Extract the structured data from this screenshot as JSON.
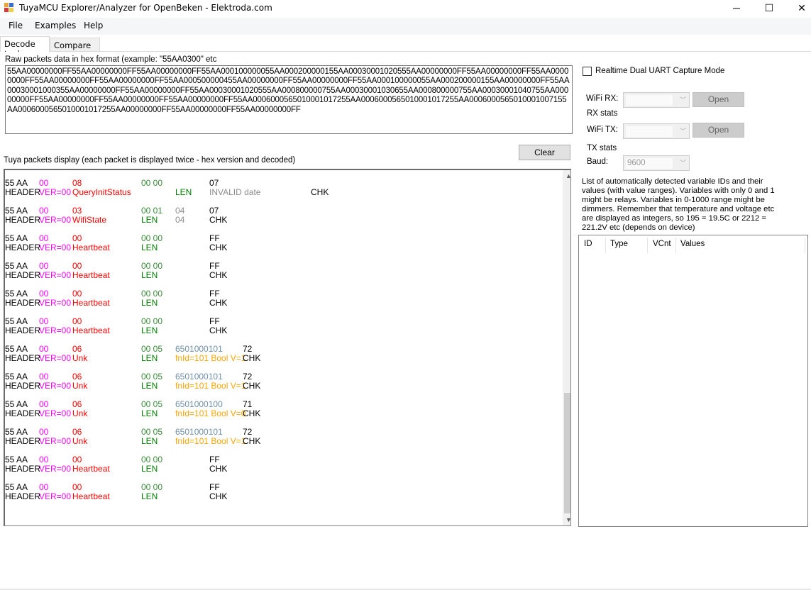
{
  "window": {
    "title": "TuyaMCU Explorer/Analyzer for OpenBeken - Elektroda.com",
    "minimize": "─",
    "maximize": "☐",
    "close": "✕"
  },
  "menu": [
    "File",
    "Examples",
    "Help"
  ],
  "tabs": [
    "Decode tool",
    "Compare tool"
  ],
  "raw": {
    "label": "Raw packets data in hex format (example: \"55AA0300\" etc",
    "value": "55AA00000000FF55AA00000000FF55AA00000000FF55AA000100000055AA000200000155AA00030001020555AA00000000FF55AA00000000FF55AA00000000FF55AA00000000FF55AA00000000FF55AA000500000455AA00000000FF55AA00000000FF55AA000100000055AA000200000155AA00000000FF55AA00030001000355AA00000000FF55AA00000000FF55AA00030001020555AA000800000755AA00030001030655AA000800000755AA00030001040755AA00000000FF55AA00000000FF55AA00000000FF55AA00000000FF55AA0006000565010001017255AA0006000565010001017255AA0006000565010001007155AA0006000565010001017255AA00000000FF55AA00000000FF55AA00000000FF"
  },
  "display": {
    "label": "Tuya packets display (each packet is displayed twice - hex version and decoded)",
    "clear": "Clear"
  },
  "packets": [
    {
      "top": [
        [
          "header",
          "55 AA",
          "black"
        ],
        [
          "ver",
          "00",
          "mag"
        ],
        [
          "cmd",
          "08",
          "red"
        ],
        [
          "len",
          "00 00",
          "teal"
        ],
        [
          "chk",
          "07",
          "black"
        ]
      ],
      "bottom": [
        [
          "header",
          "HEADER",
          "black"
        ],
        [
          "ver",
          "VER=00",
          "mag"
        ],
        [
          "cmd",
          "QueryInitStatus",
          "red"
        ],
        [
          "data",
          "LEN",
          "green"
        ],
        [
          "chk",
          "INVALID date",
          "gray"
        ],
        [
          "extra",
          "CHK",
          "black"
        ]
      ]
    },
    {
      "top": [
        [
          "header",
          "55 AA",
          "black"
        ],
        [
          "ver",
          "00",
          "mag"
        ],
        [
          "cmd",
          "03",
          "red"
        ],
        [
          "len",
          "00 01",
          "teal"
        ],
        [
          "data",
          "04",
          "gray"
        ],
        [
          "chk",
          "07",
          "black"
        ]
      ],
      "bottom": [
        [
          "header",
          "HEADER",
          "black"
        ],
        [
          "ver",
          "VER=00",
          "mag"
        ],
        [
          "cmd",
          "WifiState",
          "red"
        ],
        [
          "len",
          "LEN",
          "green"
        ],
        [
          "data",
          "04",
          "gray"
        ],
        [
          "chk",
          "CHK",
          "black"
        ]
      ]
    },
    {
      "top": [
        [
          "header",
          "55 AA",
          "black"
        ],
        [
          "ver",
          "00",
          "mag"
        ],
        [
          "cmd",
          "00",
          "red"
        ],
        [
          "len",
          "00 00",
          "teal"
        ],
        [
          "chk",
          "FF",
          "black"
        ]
      ],
      "bottom": [
        [
          "header",
          "HEADER",
          "black"
        ],
        [
          "ver",
          "VER=00",
          "mag"
        ],
        [
          "cmd",
          "Heartbeat",
          "red"
        ],
        [
          "len",
          "LEN",
          "green"
        ],
        [
          "chk",
          "CHK",
          "black"
        ]
      ]
    },
    {
      "top": [
        [
          "header",
          "55 AA",
          "black"
        ],
        [
          "ver",
          "00",
          "mag"
        ],
        [
          "cmd",
          "00",
          "red"
        ],
        [
          "len",
          "00 00",
          "teal"
        ],
        [
          "chk",
          "FF",
          "black"
        ]
      ],
      "bottom": [
        [
          "header",
          "HEADER",
          "black"
        ],
        [
          "ver",
          "VER=00",
          "mag"
        ],
        [
          "cmd",
          "Heartbeat",
          "red"
        ],
        [
          "len",
          "LEN",
          "green"
        ],
        [
          "chk",
          "CHK",
          "black"
        ]
      ]
    },
    {
      "top": [
        [
          "header",
          "55 AA",
          "black"
        ],
        [
          "ver",
          "00",
          "mag"
        ],
        [
          "cmd",
          "00",
          "red"
        ],
        [
          "len",
          "00 00",
          "teal"
        ],
        [
          "chk",
          "FF",
          "black"
        ]
      ],
      "bottom": [
        [
          "header",
          "HEADER",
          "black"
        ],
        [
          "ver",
          "VER=00",
          "mag"
        ],
        [
          "cmd",
          "Heartbeat",
          "red"
        ],
        [
          "len",
          "LEN",
          "green"
        ],
        [
          "chk",
          "CHK",
          "black"
        ]
      ]
    },
    {
      "top": [
        [
          "header",
          "55 AA",
          "black"
        ],
        [
          "ver",
          "00",
          "mag"
        ],
        [
          "cmd",
          "00",
          "red"
        ],
        [
          "len",
          "00 00",
          "teal"
        ],
        [
          "chk",
          "FF",
          "black"
        ]
      ],
      "bottom": [
        [
          "header",
          "HEADER",
          "black"
        ],
        [
          "ver",
          "VER=00",
          "mag"
        ],
        [
          "cmd",
          "Heartbeat",
          "red"
        ],
        [
          "len",
          "LEN",
          "green"
        ],
        [
          "chk",
          "CHK",
          "black"
        ]
      ]
    },
    {
      "top": [
        [
          "header",
          "55 AA",
          "black"
        ],
        [
          "ver",
          "00",
          "mag"
        ],
        [
          "cmd",
          "06",
          "red"
        ],
        [
          "len",
          "00 05",
          "teal"
        ],
        [
          "data",
          "6501000101",
          "blue"
        ],
        [
          "chk2",
          "72",
          "black"
        ]
      ],
      "bottom": [
        [
          "header",
          "HEADER",
          "black"
        ],
        [
          "ver",
          "VER=00",
          "mag"
        ],
        [
          "cmd",
          "Unk",
          "red"
        ],
        [
          "len",
          "LEN",
          "green"
        ],
        [
          "data",
          "fnId=101 Bool V=1",
          "orange"
        ],
        [
          "chk2",
          "CHK",
          "black"
        ]
      ]
    },
    {
      "top": [
        [
          "header",
          "55 AA",
          "black"
        ],
        [
          "ver",
          "00",
          "mag"
        ],
        [
          "cmd",
          "06",
          "red"
        ],
        [
          "len",
          "00 05",
          "teal"
        ],
        [
          "data",
          "6501000101",
          "blue"
        ],
        [
          "chk2",
          "72",
          "black"
        ]
      ],
      "bottom": [
        [
          "header",
          "HEADER",
          "black"
        ],
        [
          "ver",
          "VER=00",
          "mag"
        ],
        [
          "cmd",
          "Unk",
          "red"
        ],
        [
          "len",
          "LEN",
          "green"
        ],
        [
          "data",
          "fnId=101 Bool V=1",
          "orange"
        ],
        [
          "chk2",
          "CHK",
          "black"
        ]
      ]
    },
    {
      "top": [
        [
          "header",
          "55 AA",
          "black"
        ],
        [
          "ver",
          "00",
          "mag"
        ],
        [
          "cmd",
          "06",
          "red"
        ],
        [
          "len",
          "00 05",
          "teal"
        ],
        [
          "data",
          "6501000100",
          "blue"
        ],
        [
          "chk2",
          "71",
          "black"
        ]
      ],
      "bottom": [
        [
          "header",
          "HEADER",
          "black"
        ],
        [
          "ver",
          "VER=00",
          "mag"
        ],
        [
          "cmd",
          "Unk",
          "red"
        ],
        [
          "len",
          "LEN",
          "green"
        ],
        [
          "data",
          "fnId=101 Bool V=0",
          "orange"
        ],
        [
          "chk2",
          "CHK",
          "black"
        ]
      ]
    },
    {
      "top": [
        [
          "header",
          "55 AA",
          "black"
        ],
        [
          "ver",
          "00",
          "mag"
        ],
        [
          "cmd",
          "06",
          "red"
        ],
        [
          "len",
          "00 05",
          "teal"
        ],
        [
          "data",
          "6501000101",
          "blue"
        ],
        [
          "chk2",
          "72",
          "black"
        ]
      ],
      "bottom": [
        [
          "header",
          "HEADER",
          "black"
        ],
        [
          "ver",
          "VER=00",
          "mag"
        ],
        [
          "cmd",
          "Unk",
          "red"
        ],
        [
          "len",
          "LEN",
          "green"
        ],
        [
          "data",
          "fnId=101 Bool V=1",
          "orange"
        ],
        [
          "chk2",
          "CHK",
          "black"
        ]
      ]
    },
    {
      "top": [
        [
          "header",
          "55 AA",
          "black"
        ],
        [
          "ver",
          "00",
          "mag"
        ],
        [
          "cmd",
          "00",
          "red"
        ],
        [
          "len",
          "00 00",
          "teal"
        ],
        [
          "chk",
          "FF",
          "black"
        ]
      ],
      "bottom": [
        [
          "header",
          "HEADER",
          "black"
        ],
        [
          "ver",
          "VER=00",
          "mag"
        ],
        [
          "cmd",
          "Heartbeat",
          "red"
        ],
        [
          "len",
          "LEN",
          "green"
        ],
        [
          "chk",
          "CHK",
          "black"
        ]
      ]
    },
    {
      "top": [
        [
          "header",
          "55 AA",
          "black"
        ],
        [
          "ver",
          "00",
          "mag"
        ],
        [
          "cmd",
          "00",
          "red"
        ],
        [
          "len",
          "00 00",
          "teal"
        ],
        [
          "chk",
          "FF",
          "black"
        ]
      ],
      "bottom": [
        [
          "header",
          "HEADER",
          "black"
        ],
        [
          "ver",
          "VER=00",
          "mag"
        ],
        [
          "cmd",
          "Heartbeat",
          "red"
        ],
        [
          "len",
          "LEN",
          "green"
        ],
        [
          "chk",
          "CHK",
          "black"
        ]
      ]
    }
  ],
  "capture": {
    "realtime_label": "Realtime Dual UART Capture Mode",
    "realtime_checked": false,
    "wifi_rx_label": "WiFi RX:",
    "rx_stats": "RX stats",
    "wifi_tx_label": "WiFi TX:",
    "tx_stats": "TX stats",
    "baud_label": "Baud:",
    "baud_value": "9600",
    "open": "Open"
  },
  "variables": {
    "info": "List of automatically detected variable IDs  and their values (with value ranges). Variables with only 0 and 1 might be relays. Variables in 0-1000 range might be dimmers. Remember that temperature and voltage etc are displayed as integers, so 195 = 19.5C or 2212 = 221.2V etc (depends on device)",
    "columns": [
      "ID",
      "Type",
      "VCnt",
      "Values"
    ]
  }
}
